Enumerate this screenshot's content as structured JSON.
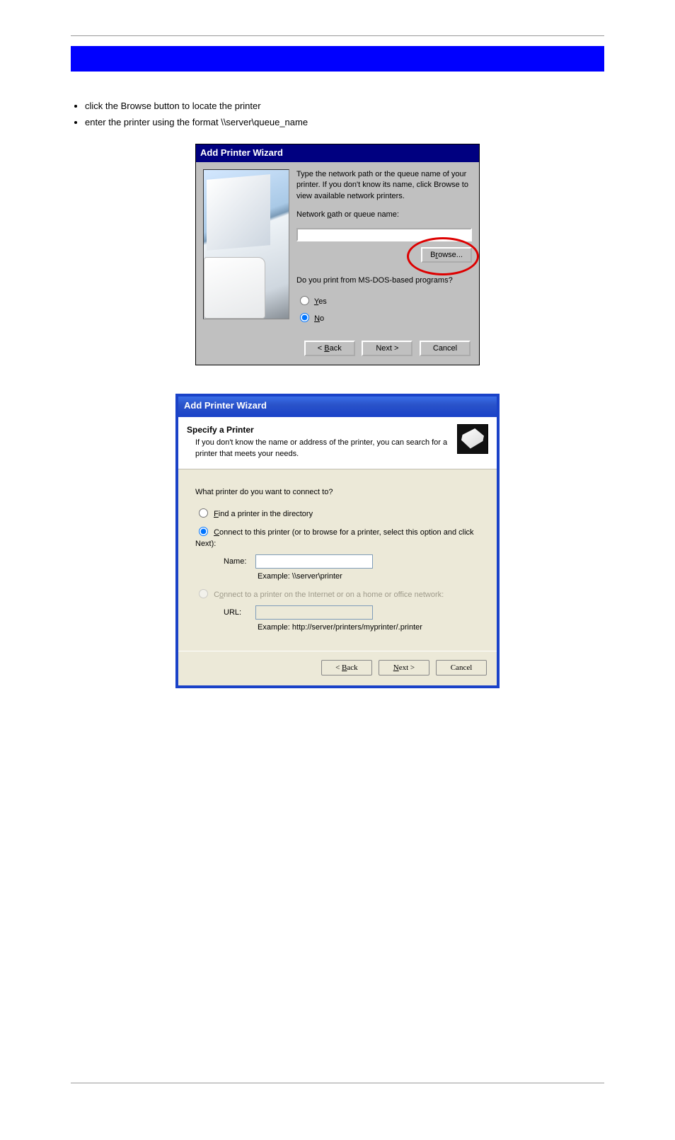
{
  "page": {
    "bullet1": "click the Browse button to locate the printer",
    "bullet2": "enter the printer using the format \\\\server\\queue_name"
  },
  "dlg98": {
    "title": "Add Printer Wizard",
    "instr": "Type the network path or the queue name of your printer. If you don't know its name, click Browse to view available network printers.",
    "path_label_pre": "Network ",
    "path_label_u": "p",
    "path_label_post": "ath or queue name:",
    "browse_pre": "B",
    "browse_u": "r",
    "browse_post": "owse...",
    "msdos": "Do you print from MS-DOS-based programs?",
    "yes_u": "Y",
    "yes_post": "es",
    "no_u": "N",
    "no_post": "o",
    "back_pre": "< ",
    "back_u": "B",
    "back_post": "ack",
    "next": "Next >",
    "cancel": "Cancel"
  },
  "dlgxp": {
    "title": "Add Printer Wizard",
    "htitle": "Specify a Printer",
    "hsub": "If you don't know the name or address of the printer, you can search for a printer that meets your needs.",
    "q": "What printer do you want to connect to?",
    "opt1_u": "F",
    "opt1_post": "ind a printer in the directory",
    "opt2_u": "C",
    "opt2_post": "onnect to this printer (or to browse for a printer, select this option and click Next):",
    "name_label": "Name:",
    "name_example": "Example: \\\\server\\printer",
    "opt3_pre": "C",
    "opt3_u": "o",
    "opt3_post": "nnect to a printer on the Internet or on a home or office network:",
    "url_label": "URL:",
    "url_example": "Example: http://server/printers/myprinter/.printer",
    "back_pre": "< ",
    "back_u": "B",
    "back_post": "ack",
    "next_u": "N",
    "next_post": "ext >",
    "cancel": "Cancel"
  }
}
